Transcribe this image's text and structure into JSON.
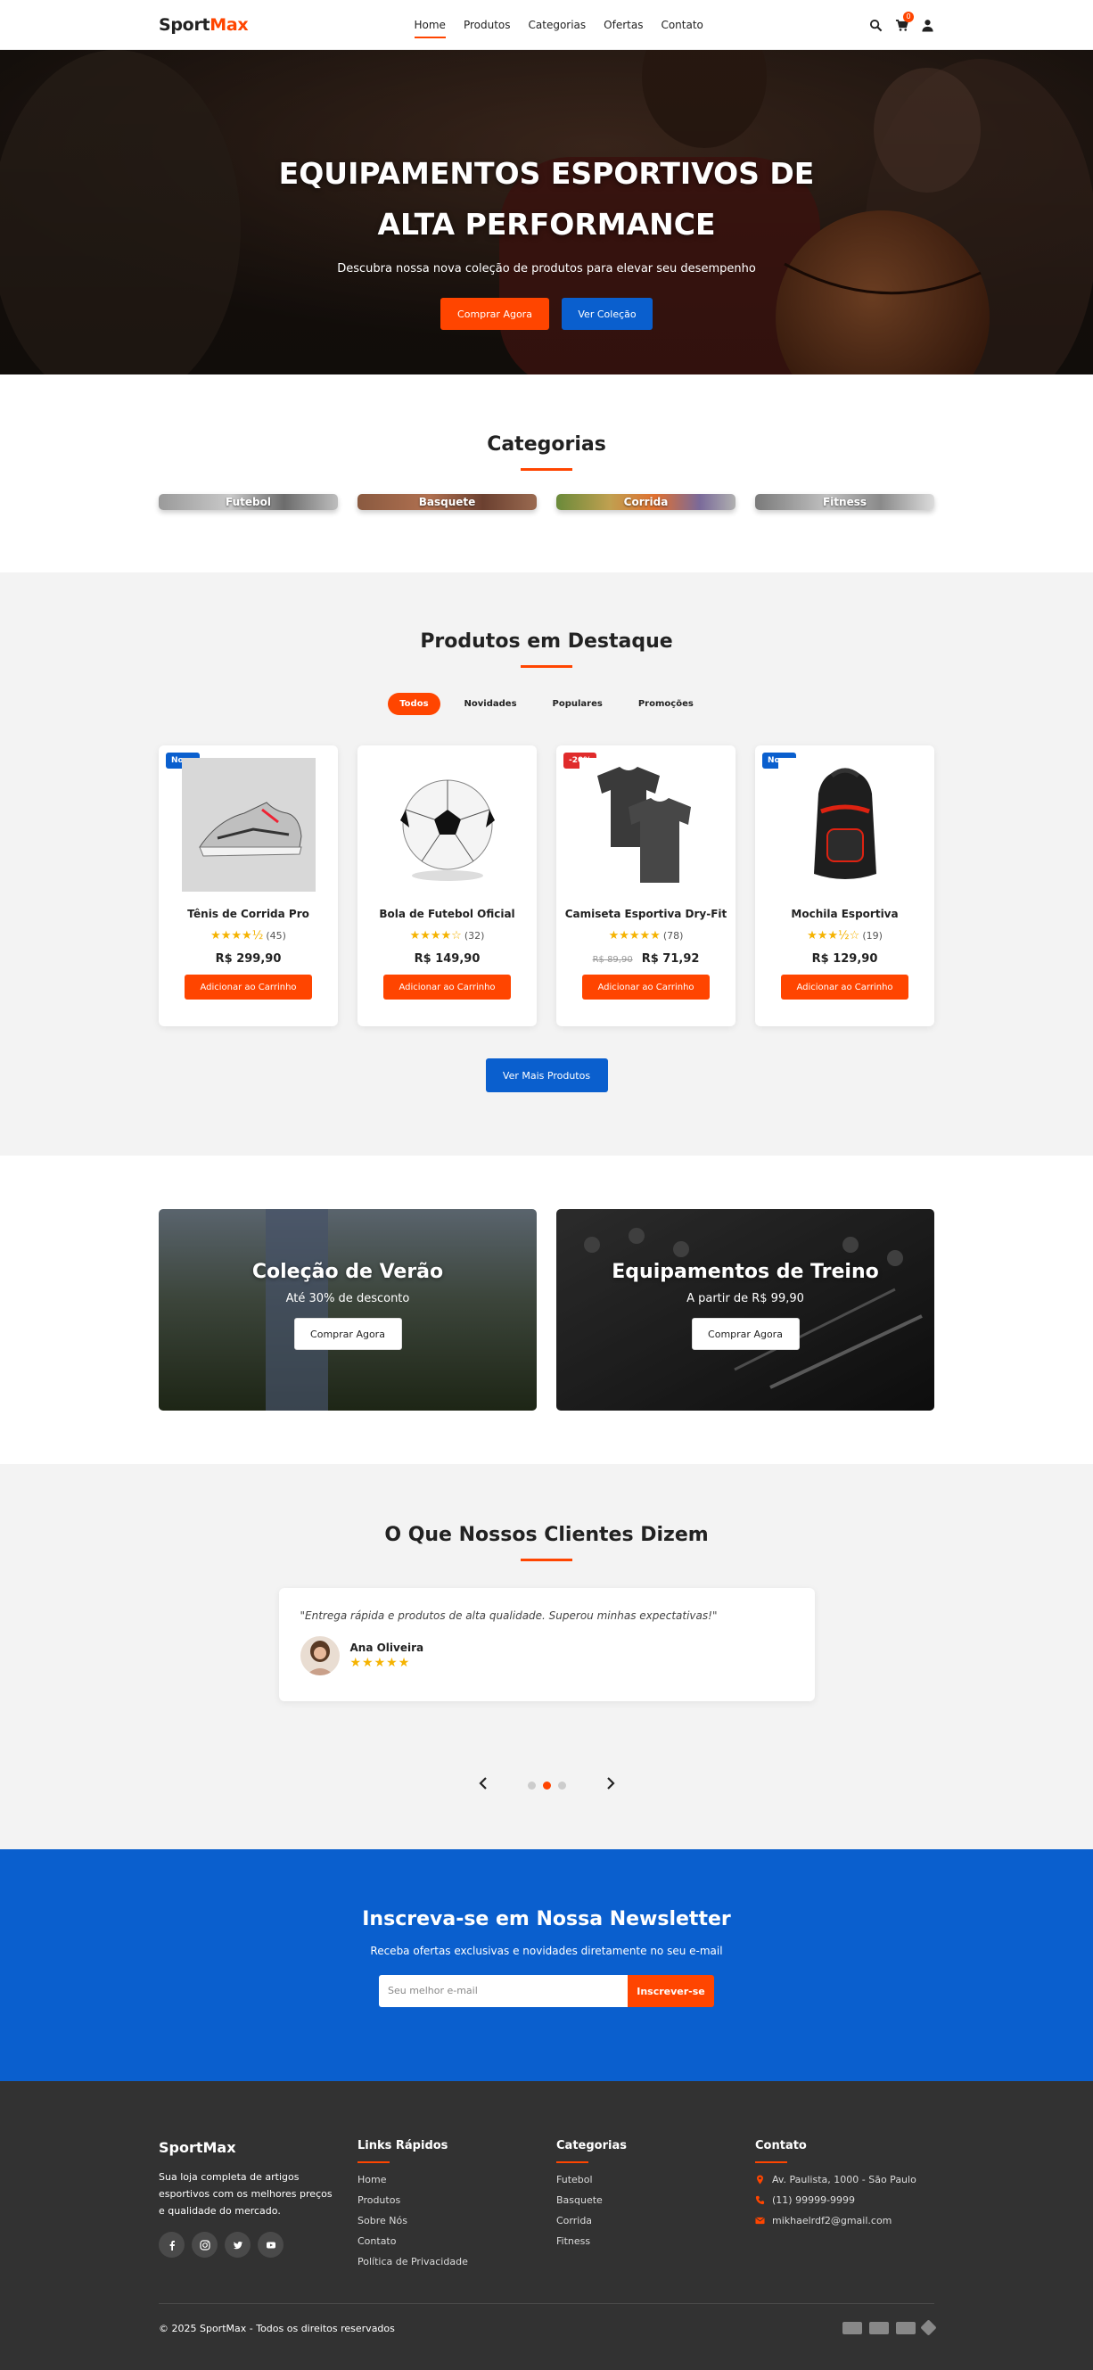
{
  "header": {
    "logo_main": "Sport",
    "logo_accent": "Max",
    "nav": [
      "Home",
      "Produtos",
      "Categorias",
      "Ofertas",
      "Contato"
    ],
    "cart_count": "0"
  },
  "hero": {
    "title_line1": "EQUIPAMENTOS ESPORTIVOS DE",
    "title_line2": "ALTA PERFORMANCE",
    "subtitle": "Descubra nossa nova coleção de produtos para elevar seu desempenho",
    "btn_primary": "Comprar Agora",
    "btn_secondary": "Ver Coleção"
  },
  "categories": {
    "title": "Categorias",
    "items": [
      "Futebol",
      "Basquete",
      "Corrida",
      "Fitness"
    ]
  },
  "products": {
    "title": "Produtos em Destaque",
    "filters": [
      "Todos",
      "Novidades",
      "Populares",
      "Promoções"
    ],
    "items": [
      {
        "tag": "Novo",
        "name": "Tênis de Corrida Pro",
        "stars": "★★★★½",
        "rating": "(45)",
        "old_price": "",
        "price": "R$ 299,90",
        "button": "Adicionar ao Carrinho"
      },
      {
        "tag": "",
        "name": "Bola de Futebol Oficial",
        "stars": "★★★★☆",
        "rating": "(32)",
        "old_price": "",
        "price": "R$ 149,90",
        "button": "Adicionar ao Carrinho"
      },
      {
        "tag": "-20%",
        "name": "Camiseta Esportiva Dry-Fit",
        "stars": "★★★★★",
        "rating": "(78)",
        "old_price": "R$ 89,90",
        "price": "R$ 71,92",
        "button": "Adicionar ao Carrinho"
      },
      {
        "tag": "Novo",
        "name": "Mochila Esportiva",
        "stars": "★★★½☆",
        "rating": "(19)",
        "old_price": "",
        "price": "R$ 129,90",
        "button": "Adicionar ao Carrinho"
      }
    ],
    "more_button": "Ver Mais Produtos"
  },
  "promos": [
    {
      "title": "Coleção de Verão",
      "subtitle": "Até 30% de desconto",
      "button": "Comprar Agora"
    },
    {
      "title": "Equipamentos de Treino",
      "subtitle": "A partir de R$ 99,90",
      "button": "Comprar Agora"
    }
  ],
  "testimonials": {
    "title": "O Que Nossos Clientes Dizem",
    "quote": "\"Entrega rápida e produtos de alta qualidade. Superou minhas expectativas!\"",
    "name": "Ana Oliveira",
    "stars": "★★★★★"
  },
  "newsletter": {
    "title": "Inscreva-se em Nossa Newsletter",
    "subtitle": "Receba ofertas exclusivas e novidades diretamente no seu e-mail",
    "placeholder": "Seu melhor e-mail",
    "button": "Inscrever-se"
  },
  "footer": {
    "brand": "SportMax",
    "description": "Sua loja completa de artigos esportivos com os melhores preços e qualidade do mercado.",
    "links_title": "Links Rápidos",
    "links": [
      "Home",
      "Produtos",
      "Sobre Nós",
      "Contato",
      "Política de Privacidade"
    ],
    "cats_title": "Categorias",
    "cats": [
      "Futebol",
      "Basquete",
      "Corrida",
      "Fitness"
    ],
    "contact_title": "Contato",
    "address": "Av. Paulista, 1000 - São Paulo",
    "phone": "(11) 99999-9999",
    "email": "mikhaelrdf2@gmail.com",
    "copyright": "© 2025 SportMax - Todos os direitos reservados"
  },
  "colors": {
    "accent": "#ff4500",
    "blue": "#0a5fce",
    "footer": "#323232"
  }
}
